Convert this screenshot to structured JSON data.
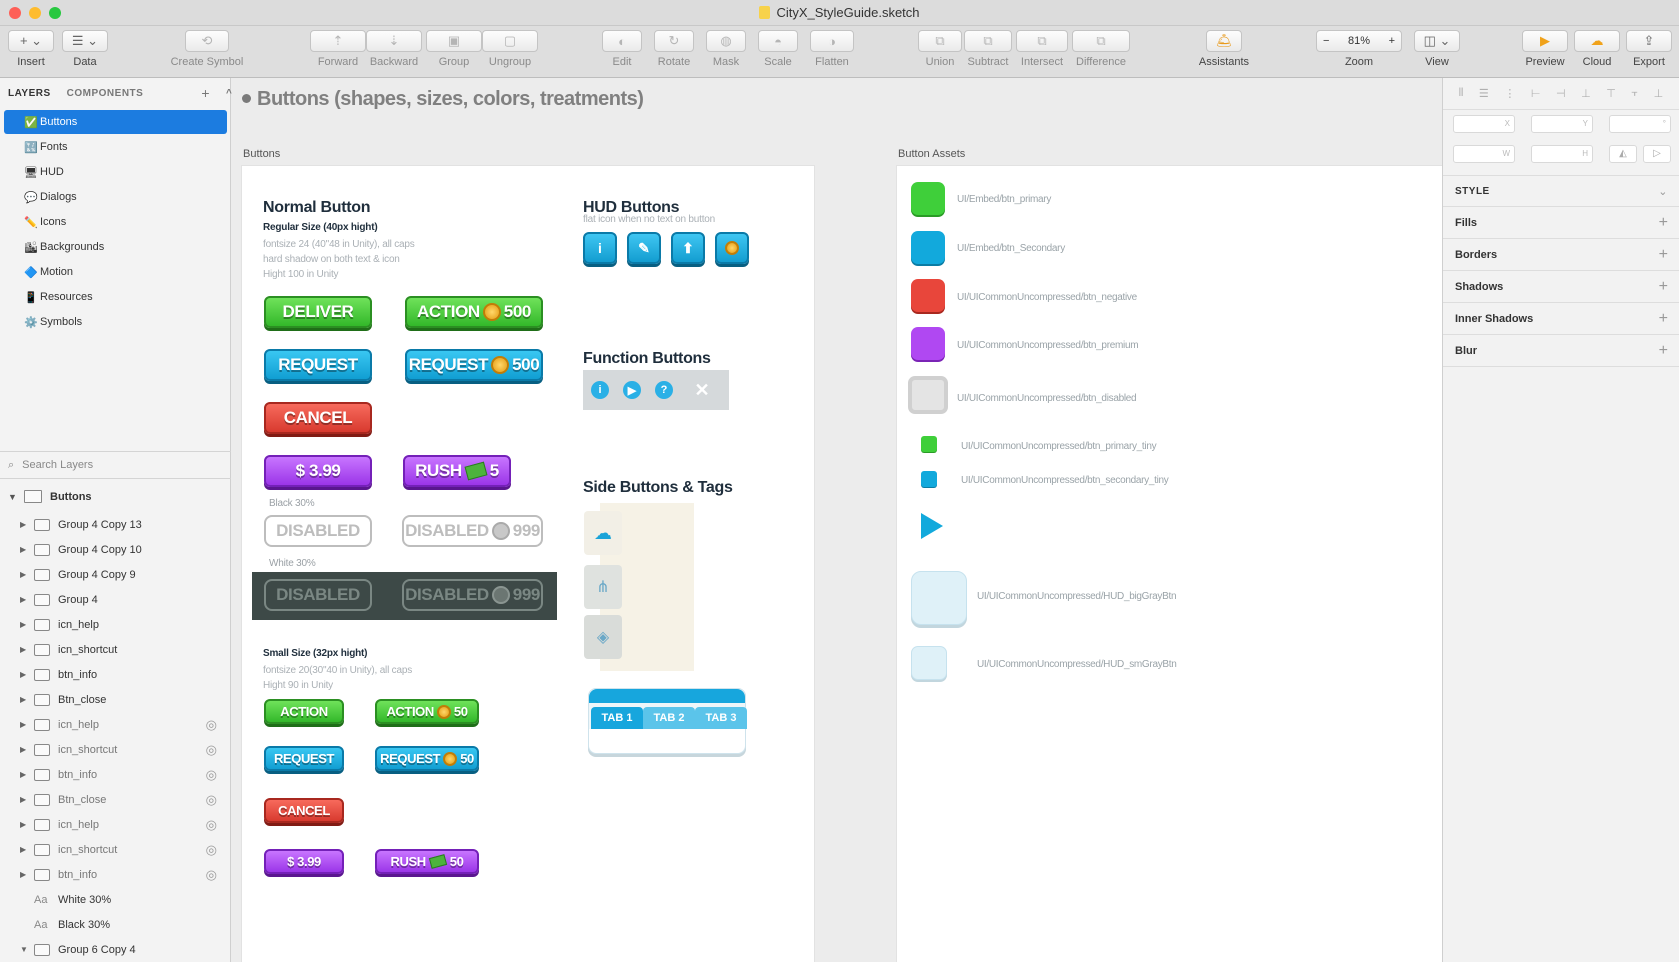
{
  "window": {
    "title": "CityX_StyleGuide.sketch"
  },
  "toolbar": {
    "items": [
      {
        "label": "Insert",
        "glyph": "+ ⌄"
      },
      {
        "label": "Data",
        "glyph": "☰ ⌄"
      },
      {
        "label": "Create Symbol",
        "glyph": "⟲"
      },
      {
        "label": "Forward",
        "glyph": "⇡"
      },
      {
        "label": "Backward",
        "glyph": "⇣"
      },
      {
        "label": "Group",
        "glyph": "▣"
      },
      {
        "label": "Ungroup",
        "glyph": "▢"
      },
      {
        "label": "Edit",
        "glyph": "◐"
      },
      {
        "label": "Rotate",
        "glyph": "↻"
      },
      {
        "label": "Mask",
        "glyph": "◍"
      },
      {
        "label": "Scale",
        "glyph": "◓"
      },
      {
        "label": "Flatten",
        "glyph": "◑"
      },
      {
        "label": "Union",
        "glyph": "⧉"
      },
      {
        "label": "Subtract",
        "glyph": "⧉"
      },
      {
        "label": "Intersect",
        "glyph": "⧉"
      },
      {
        "label": "Difference",
        "glyph": "⧉"
      },
      {
        "label": "Assistants",
        "glyph": "🛎"
      },
      {
        "label": "Zoom",
        "glyph": "81%",
        "minus": "−",
        "plus": "+"
      },
      {
        "label": "View",
        "glyph": "◫ ⌄"
      },
      {
        "label": "Preview",
        "glyph": "▶"
      },
      {
        "label": "Cloud",
        "glyph": "☁"
      },
      {
        "label": "Export",
        "glyph": "⇪"
      }
    ]
  },
  "sidebar": {
    "tabs": {
      "layers": "LAYERS",
      "components": "COMPONENTS",
      "add": "+",
      "collapse": "^"
    },
    "pages": [
      {
        "emoji": "✅",
        "label": "Buttons"
      },
      {
        "emoji": "🔣",
        "label": "Fonts"
      },
      {
        "emoji": "🖥",
        "label": "HUD"
      },
      {
        "emoji": "💬",
        "label": "Dialogs"
      },
      {
        "emoji": "✏️",
        "label": "Icons"
      },
      {
        "emoji": "🏙",
        "label": "Backgrounds"
      },
      {
        "emoji": "🔷",
        "label": "Motion"
      },
      {
        "emoji": "📱",
        "label": "Resources"
      },
      {
        "emoji": "⚙️",
        "label": "Symbols"
      }
    ],
    "search_placeholder": "Search Layers",
    "artboard": "Buttons",
    "layers": [
      "Group 4 Copy 13",
      "Group 4 Copy 10",
      "Group 4 Copy 9",
      "Group 4",
      "icn_help",
      "icn_shortcut",
      "btn_info",
      "Btn_close",
      "icn_help",
      "icn_shortcut",
      "btn_info",
      "Btn_close",
      "icn_help",
      "icn_shortcut",
      "btn_info",
      "White 30%",
      "Black 30%",
      "Group 6 Copy 4"
    ]
  },
  "canvas": {
    "page_heading": "Buttons (shapes, sizes, colors, treatments)",
    "artboard1_label": "Buttons",
    "artboard2_label": "Button Assets",
    "normal": {
      "title": "Normal Button",
      "subtitle": "Regular Size (40px hight)",
      "note": [
        "fontsize 24 (40\"48 in Unity), all caps",
        "hard shadow on both text & icon",
        "Hight 100 in Unity"
      ],
      "deliver": "DELIVER",
      "action": "ACTION",
      "action_num": "500",
      "request": "REQUEST",
      "request_num": "500",
      "cancel": "CANCEL",
      "price": "$ 3.99",
      "rush": "RUSH",
      "rush_num": "5",
      "black30": "Black 30%",
      "disabled": "DISABLED",
      "disabled_num": "999",
      "white30": "White 30%"
    },
    "small": {
      "subtitle": "Small Size (32px hight)",
      "note": [
        "fontsize 20(30\"40 in Unity), all caps",
        "Hight 90 in Unity"
      ],
      "action": "ACTION",
      "action_num": "50",
      "request": "REQUEST",
      "request_num": "50",
      "cancel": "CANCEL",
      "price": "$ 3.99",
      "rush": "RUSH",
      "rush_num": "50"
    },
    "hud": {
      "title": "HUD Buttons",
      "note": "flat icon when no text on button"
    },
    "function": {
      "title": "Function Buttons"
    },
    "side": {
      "title": "Side Buttons & Tags",
      "tabs": [
        "TAB 1",
        "TAB 2",
        "TAB 3"
      ]
    },
    "assets": [
      {
        "name": "UI/Embed/btn_primary",
        "color": "#3fcf3a"
      },
      {
        "name": "UI/Embed/btn_Secondary",
        "color": "#12a9dc"
      },
      {
        "name": "UI/UICommonUncompressed/btn_negative",
        "color": "#e8463b"
      },
      {
        "name": "UI/UICommonUncompressed/btn_premium",
        "color": "#b048f2"
      },
      {
        "name": "UI/UICommonUncompressed/btn_disabled",
        "color": "#e4e4e4"
      },
      {
        "name": "UI/UICommonUncompressed/btn_primary_tiny",
        "color": "#3fcf3a"
      },
      {
        "name": "UI/UICommonUncompressed/btn_secondary_tiny",
        "color": "#12a9dc"
      },
      {
        "name": "UI/UICommonUncompressed/HUD_bigGrayBtn",
        "color": "#dff1f8"
      },
      {
        "name": "UI/UICommonUncompressed/HUD_smGrayBtn",
        "color": "#dff1f8"
      }
    ]
  },
  "inspector": {
    "fields": {
      "x": "X",
      "y": "Y",
      "r": "°",
      "w": "W",
      "h": "H"
    },
    "sections": [
      "STYLE",
      "Fills",
      "Borders",
      "Shadows",
      "Inner Shadows",
      "Blur"
    ]
  }
}
